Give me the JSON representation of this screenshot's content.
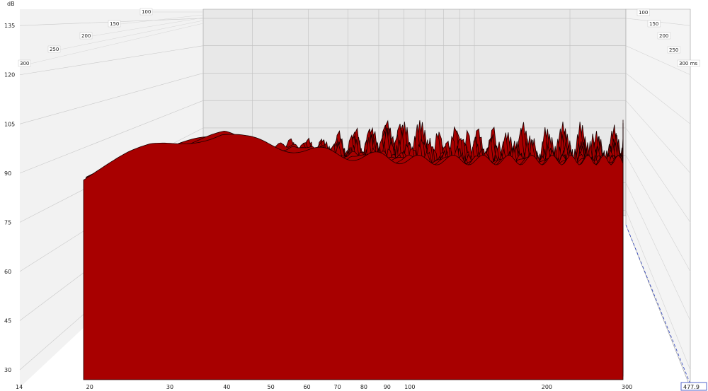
{
  "chart_data": {
    "type": "area",
    "ylabel": "dB",
    "ylim": [
      27,
      140
    ],
    "y_ticks": [
      30,
      45,
      60,
      75,
      90,
      105,
      120,
      135
    ],
    "x_log_scale": true,
    "xlim": [
      14,
      300
    ],
    "x_ticks": [
      {
        "value": 14,
        "label": "14"
      },
      {
        "value": 20,
        "label": "20"
      },
      {
        "value": 30,
        "label": "30"
      },
      {
        "value": 40,
        "label": "40"
      },
      {
        "value": 50,
        "label": "50"
      },
      {
        "value": 60,
        "label": "60"
      },
      {
        "value": 70,
        "label": "70"
      },
      {
        "value": 80,
        "label": "80"
      },
      {
        "value": 90,
        "label": "90"
      },
      {
        "value": 100,
        "label": "100"
      },
      {
        "value": 200,
        "label": "200"
      },
      {
        "value": 300,
        "label": "300"
      }
    ],
    "time_unit": "ms",
    "time_ticks_left": [
      {
        "value": 100,
        "label": "100"
      },
      {
        "value": 150,
        "label": "150"
      },
      {
        "value": 200,
        "label": "200"
      },
      {
        "value": 250,
        "label": "250"
      },
      {
        "value": 300,
        "label": "300"
      }
    ],
    "time_ticks_right": [
      {
        "value": 100,
        "label": "100"
      },
      {
        "value": 150,
        "label": "150"
      },
      {
        "value": 200,
        "label": "200"
      },
      {
        "value": 250,
        "label": "250"
      },
      {
        "value": 300,
        "label": "300 ms"
      }
    ],
    "cursor_readout": "477.9",
    "fill_color": "#a80000",
    "edge_color": "#1a0000",
    "panel_color": "#e8e8e8",
    "front_profile": {
      "freq_hz": [
        20,
        22,
        25,
        28,
        30,
        33,
        36,
        40,
        45,
        50,
        55,
        60,
        70,
        80,
        90,
        100,
        120,
        140,
        160,
        180,
        200,
        220,
        250,
        300
      ],
      "level_db": [
        88,
        91,
        95,
        98,
        99,
        100,
        101,
        102,
        100,
        99,
        98,
        97,
        96,
        95,
        95,
        94,
        94,
        94,
        94,
        94,
        94,
        94,
        94,
        94
      ]
    },
    "resonance_freq_hz": [
      52,
      56,
      62,
      75,
      85,
      100,
      125,
      140,
      170,
      190,
      210,
      230,
      265,
      280
    ]
  }
}
